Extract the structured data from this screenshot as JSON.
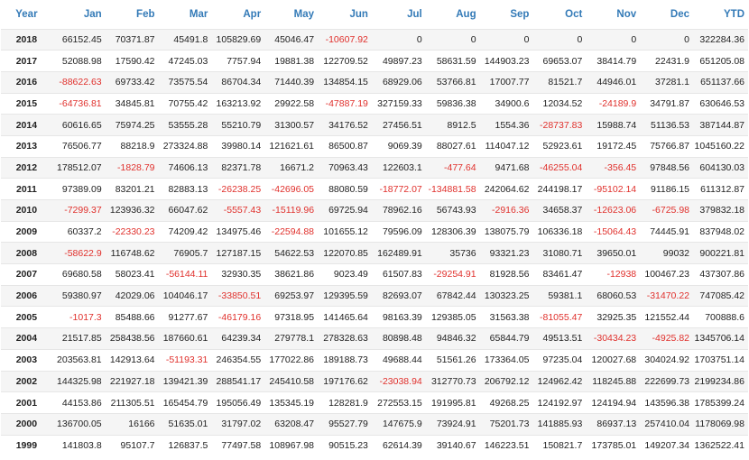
{
  "header": [
    "Year",
    "Jan",
    "Feb",
    "Mar",
    "Apr",
    "May",
    "Jun",
    "Jul",
    "Aug",
    "Sep",
    "Oct",
    "Nov",
    "Dec",
    "YTD"
  ],
  "negative_color": "#e0302c",
  "header_color": "#337ab7",
  "rows": [
    [
      "2018",
      "66152.45",
      "70371.87",
      "45491.8",
      "105829.69",
      "45046.47",
      "-10607.92",
      "0",
      "0",
      "0",
      "0",
      "0",
      "0",
      "322284.36"
    ],
    [
      "2017",
      "52088.98",
      "17590.42",
      "47245.03",
      "7757.94",
      "19881.38",
      "122709.52",
      "49897.23",
      "58631.59",
      "144903.23",
      "69653.07",
      "38414.79",
      "22431.9",
      "651205.08"
    ],
    [
      "2016",
      "-88622.63",
      "69733.42",
      "73575.54",
      "86704.34",
      "71440.39",
      "134854.15",
      "68929.06",
      "53766.81",
      "17007.77",
      "81521.7",
      "44946.01",
      "37281.1",
      "651137.66"
    ],
    [
      "2015",
      "-64736.81",
      "34845.81",
      "70755.42",
      "163213.92",
      "29922.58",
      "-47887.19",
      "327159.33",
      "59836.38",
      "34900.6",
      "12034.52",
      "-24189.9",
      "34791.87",
      "630646.53"
    ],
    [
      "2014",
      "60616.65",
      "75974.25",
      "53555.28",
      "55210.79",
      "31300.57",
      "34176.52",
      "27456.51",
      "8912.5",
      "1554.36",
      "-28737.83",
      "15988.74",
      "51136.53",
      "387144.87"
    ],
    [
      "2013",
      "76506.77",
      "88218.9",
      "273324.88",
      "39980.14",
      "121621.61",
      "86500.87",
      "9069.39",
      "88027.61",
      "114047.12",
      "52923.61",
      "19172.45",
      "75766.87",
      "1045160.22"
    ],
    [
      "2012",
      "178512.07",
      "-1828.79",
      "74606.13",
      "82371.78",
      "16671.2",
      "70963.43",
      "122603.1",
      "-477.64",
      "9471.68",
      "-46255.04",
      "-356.45",
      "97848.56",
      "604130.03"
    ],
    [
      "2011",
      "97389.09",
      "83201.21",
      "82883.13",
      "-26238.25",
      "-42696.05",
      "88080.59",
      "-18772.07",
      "-134881.58",
      "242064.62",
      "244198.17",
      "-95102.14",
      "91186.15",
      "611312.87"
    ],
    [
      "2010",
      "-7299.37",
      "123936.32",
      "66047.62",
      "-5557.43",
      "-15119.96",
      "69725.94",
      "78962.16",
      "56743.93",
      "-2916.36",
      "34658.37",
      "-12623.06",
      "-6725.98",
      "379832.18"
    ],
    [
      "2009",
      "60337.2",
      "-22330.23",
      "74209.42",
      "134975.46",
      "-22594.88",
      "101655.12",
      "79596.09",
      "128306.39",
      "138075.79",
      "106336.18",
      "-15064.43",
      "74445.91",
      "837948.02"
    ],
    [
      "2008",
      "-58622.9",
      "116748.62",
      "76905.7",
      "127187.15",
      "54622.53",
      "122070.85",
      "162489.91",
      "35736",
      "93321.23",
      "31080.71",
      "39650.01",
      "99032",
      "900221.81"
    ],
    [
      "2007",
      "69680.58",
      "58023.41",
      "-56144.11",
      "32930.35",
      "38621.86",
      "9023.49",
      "61507.83",
      "-29254.91",
      "81928.56",
      "83461.47",
      "-12938",
      "100467.23",
      "437307.86"
    ],
    [
      "2006",
      "59380.97",
      "42029.06",
      "104046.17",
      "-33850.51",
      "69253.97",
      "129395.59",
      "82693.07",
      "67842.44",
      "130323.25",
      "59381.1",
      "68060.53",
      "-31470.22",
      "747085.42"
    ],
    [
      "2005",
      "-1017.3",
      "85488.66",
      "91277.67",
      "-46179.16",
      "97318.95",
      "141465.64",
      "98163.39",
      "129385.05",
      "31563.38",
      "-81055.47",
      "32925.35",
      "121552.44",
      "700888.6"
    ],
    [
      "2004",
      "21517.85",
      "258438.56",
      "187660.61",
      "64239.34",
      "279778.1",
      "278328.63",
      "80898.48",
      "94846.32",
      "65844.79",
      "49513.51",
      "-30434.23",
      "-4925.82",
      "1345706.14"
    ],
    [
      "2003",
      "203563.81",
      "142913.64",
      "-51193.31",
      "246354.55",
      "177022.86",
      "189188.73",
      "49688.44",
      "51561.26",
      "173364.05",
      "97235.04",
      "120027.68",
      "304024.92",
      "1703751.14"
    ],
    [
      "2002",
      "144325.98",
      "221927.18",
      "139421.39",
      "288541.17",
      "245410.58",
      "197176.62",
      "-23038.94",
      "312770.73",
      "206792.12",
      "124962.42",
      "118245.88",
      "222699.73",
      "2199234.86"
    ],
    [
      "2001",
      "44153.86",
      "211305.51",
      "165454.79",
      "195056.49",
      "135345.19",
      "128281.9",
      "272553.15",
      "191995.81",
      "49268.25",
      "124192.97",
      "124194.94",
      "143596.38",
      "1785399.24"
    ],
    [
      "2000",
      "136700.05",
      "16166",
      "51635.01",
      "31797.02",
      "63208.47",
      "95527.79",
      "147675.9",
      "73924.91",
      "75201.73",
      "141885.93",
      "86937.13",
      "257410.04",
      "1178069.98"
    ],
    [
      "1999",
      "141803.8",
      "95107.7",
      "126837.5",
      "77497.58",
      "108967.98",
      "90515.23",
      "62614.39",
      "39140.67",
      "146223.51",
      "150821.7",
      "173785.01",
      "149207.34",
      "1362522.41"
    ]
  ]
}
